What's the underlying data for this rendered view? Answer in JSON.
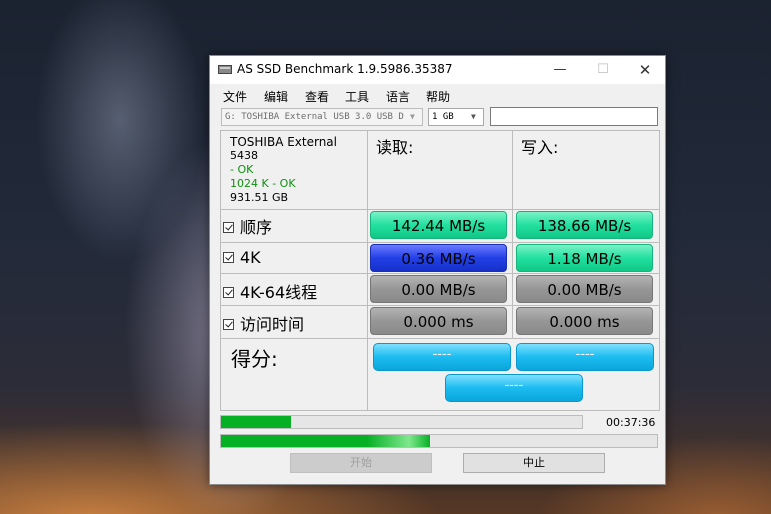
{
  "window": {
    "title": "AS SSD Benchmark 1.9.5986.35387",
    "minimize": "—",
    "maximize": "☐",
    "close": "✕"
  },
  "menu": [
    "文件",
    "编辑",
    "查看",
    "工具",
    "语言",
    "帮助"
  ],
  "toolbar": {
    "drive": "G: TOSHIBA External USB 3.0 USB D",
    "size": "1 GB",
    "text_value": ""
  },
  "drive_info": {
    "name": "TOSHIBA External",
    "firmware": "5438",
    "status1": " - OK",
    "status2": "1024 K - OK",
    "capacity": "931.51 GB"
  },
  "columns": {
    "read": "读取:",
    "write": "写入:"
  },
  "tests": [
    {
      "label": "顺序",
      "read": "142.44 MB/s",
      "write": "138.66 MB/s"
    },
    {
      "label": "4K",
      "read": "0.36 MB/s",
      "write": "1.18 MB/s"
    },
    {
      "label": "4K-64线程",
      "read": "0.00 MB/s",
      "write": "0.00 MB/s"
    },
    {
      "label": "访问时间",
      "read": "0.000 ms",
      "write": "0.000 ms"
    }
  ],
  "score": {
    "label": "得分:",
    "read": "----",
    "write": "----",
    "total": "----"
  },
  "progress": {
    "current": 0.195,
    "overall": 0.48,
    "elapsed": "00:37:36"
  },
  "buttons": {
    "start": "开始",
    "abort": "中止"
  },
  "colors": {
    "green": "#22e0a0",
    "blue": "#2340e6",
    "gray": "#969696",
    "score": "#1cbcf0",
    "progress": "#06b025"
  }
}
